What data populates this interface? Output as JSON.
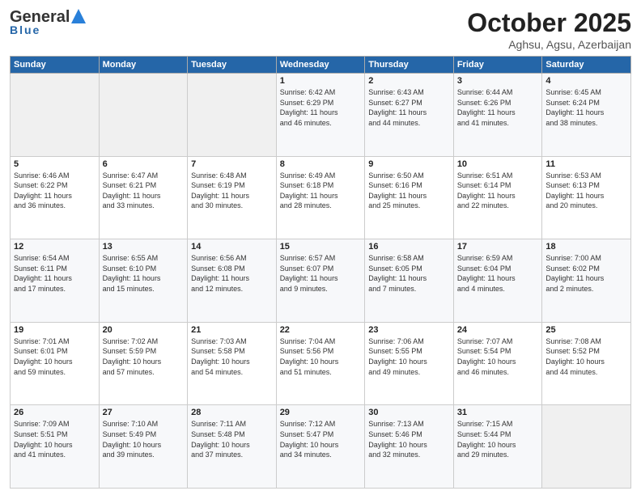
{
  "header": {
    "logo_line1": "General",
    "logo_line2": "Blue",
    "title": "October 2025",
    "subtitle": "Aghsu, Agsu, Azerbaijan"
  },
  "columns": [
    "Sunday",
    "Monday",
    "Tuesday",
    "Wednesday",
    "Thursday",
    "Friday",
    "Saturday"
  ],
  "rows": [
    [
      {
        "day": "",
        "info": ""
      },
      {
        "day": "",
        "info": ""
      },
      {
        "day": "",
        "info": ""
      },
      {
        "day": "1",
        "info": "Sunrise: 6:42 AM\nSunset: 6:29 PM\nDaylight: 11 hours\nand 46 minutes."
      },
      {
        "day": "2",
        "info": "Sunrise: 6:43 AM\nSunset: 6:27 PM\nDaylight: 11 hours\nand 44 minutes."
      },
      {
        "day": "3",
        "info": "Sunrise: 6:44 AM\nSunset: 6:26 PM\nDaylight: 11 hours\nand 41 minutes."
      },
      {
        "day": "4",
        "info": "Sunrise: 6:45 AM\nSunset: 6:24 PM\nDaylight: 11 hours\nand 38 minutes."
      }
    ],
    [
      {
        "day": "5",
        "info": "Sunrise: 6:46 AM\nSunset: 6:22 PM\nDaylight: 11 hours\nand 36 minutes."
      },
      {
        "day": "6",
        "info": "Sunrise: 6:47 AM\nSunset: 6:21 PM\nDaylight: 11 hours\nand 33 minutes."
      },
      {
        "day": "7",
        "info": "Sunrise: 6:48 AM\nSunset: 6:19 PM\nDaylight: 11 hours\nand 30 minutes."
      },
      {
        "day": "8",
        "info": "Sunrise: 6:49 AM\nSunset: 6:18 PM\nDaylight: 11 hours\nand 28 minutes."
      },
      {
        "day": "9",
        "info": "Sunrise: 6:50 AM\nSunset: 6:16 PM\nDaylight: 11 hours\nand 25 minutes."
      },
      {
        "day": "10",
        "info": "Sunrise: 6:51 AM\nSunset: 6:14 PM\nDaylight: 11 hours\nand 22 minutes."
      },
      {
        "day": "11",
        "info": "Sunrise: 6:53 AM\nSunset: 6:13 PM\nDaylight: 11 hours\nand 20 minutes."
      }
    ],
    [
      {
        "day": "12",
        "info": "Sunrise: 6:54 AM\nSunset: 6:11 PM\nDaylight: 11 hours\nand 17 minutes."
      },
      {
        "day": "13",
        "info": "Sunrise: 6:55 AM\nSunset: 6:10 PM\nDaylight: 11 hours\nand 15 minutes."
      },
      {
        "day": "14",
        "info": "Sunrise: 6:56 AM\nSunset: 6:08 PM\nDaylight: 11 hours\nand 12 minutes."
      },
      {
        "day": "15",
        "info": "Sunrise: 6:57 AM\nSunset: 6:07 PM\nDaylight: 11 hours\nand 9 minutes."
      },
      {
        "day": "16",
        "info": "Sunrise: 6:58 AM\nSunset: 6:05 PM\nDaylight: 11 hours\nand 7 minutes."
      },
      {
        "day": "17",
        "info": "Sunrise: 6:59 AM\nSunset: 6:04 PM\nDaylight: 11 hours\nand 4 minutes."
      },
      {
        "day": "18",
        "info": "Sunrise: 7:00 AM\nSunset: 6:02 PM\nDaylight: 11 hours\nand 2 minutes."
      }
    ],
    [
      {
        "day": "19",
        "info": "Sunrise: 7:01 AM\nSunset: 6:01 PM\nDaylight: 10 hours\nand 59 minutes."
      },
      {
        "day": "20",
        "info": "Sunrise: 7:02 AM\nSunset: 5:59 PM\nDaylight: 10 hours\nand 57 minutes."
      },
      {
        "day": "21",
        "info": "Sunrise: 7:03 AM\nSunset: 5:58 PM\nDaylight: 10 hours\nand 54 minutes."
      },
      {
        "day": "22",
        "info": "Sunrise: 7:04 AM\nSunset: 5:56 PM\nDaylight: 10 hours\nand 51 minutes."
      },
      {
        "day": "23",
        "info": "Sunrise: 7:06 AM\nSunset: 5:55 PM\nDaylight: 10 hours\nand 49 minutes."
      },
      {
        "day": "24",
        "info": "Sunrise: 7:07 AM\nSunset: 5:54 PM\nDaylight: 10 hours\nand 46 minutes."
      },
      {
        "day": "25",
        "info": "Sunrise: 7:08 AM\nSunset: 5:52 PM\nDaylight: 10 hours\nand 44 minutes."
      }
    ],
    [
      {
        "day": "26",
        "info": "Sunrise: 7:09 AM\nSunset: 5:51 PM\nDaylight: 10 hours\nand 41 minutes."
      },
      {
        "day": "27",
        "info": "Sunrise: 7:10 AM\nSunset: 5:49 PM\nDaylight: 10 hours\nand 39 minutes."
      },
      {
        "day": "28",
        "info": "Sunrise: 7:11 AM\nSunset: 5:48 PM\nDaylight: 10 hours\nand 37 minutes."
      },
      {
        "day": "29",
        "info": "Sunrise: 7:12 AM\nSunset: 5:47 PM\nDaylight: 10 hours\nand 34 minutes."
      },
      {
        "day": "30",
        "info": "Sunrise: 7:13 AM\nSunset: 5:46 PM\nDaylight: 10 hours\nand 32 minutes."
      },
      {
        "day": "31",
        "info": "Sunrise: 7:15 AM\nSunset: 5:44 PM\nDaylight: 10 hours\nand 29 minutes."
      },
      {
        "day": "",
        "info": ""
      }
    ]
  ]
}
